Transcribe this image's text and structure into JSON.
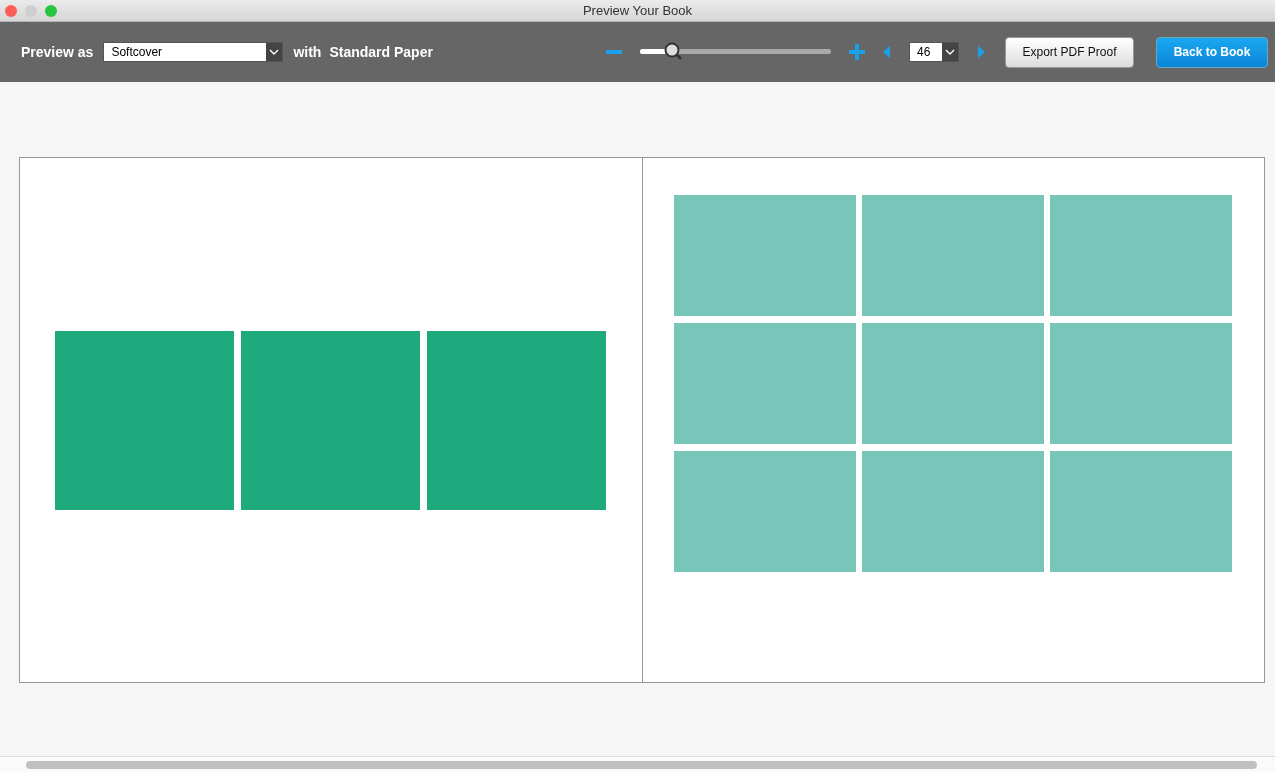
{
  "window": {
    "title": "Preview Your Book"
  },
  "toolbar": {
    "preview_label": "Preview as",
    "format": {
      "value": "Softcover"
    },
    "with_label": "with",
    "paper": "Standard Paper",
    "zoom": {
      "level": 0.17
    },
    "page": {
      "value": "46"
    },
    "buttons": [
      {
        "label": "Export PDF Proof",
        "kind": "secondary"
      },
      {
        "label": "Back to Book",
        "kind": "primary"
      }
    ]
  },
  "spread": {
    "pages": [
      {
        "kind": "row",
        "color": "#1eaa7c",
        "slots": [
          {
            "kind": "photo-slot"
          },
          {
            "kind": "photo-slot"
          },
          {
            "kind": "photo-slot"
          }
        ]
      },
      {
        "kind": "grid",
        "color": "#78c6ba",
        "slots": [
          {
            "kind": "photo-slot"
          },
          {
            "kind": "photo-slot"
          },
          {
            "kind": "photo-slot"
          },
          {
            "kind": "photo-slot"
          },
          {
            "kind": "photo-slot"
          },
          {
            "kind": "photo-slot"
          },
          {
            "kind": "photo-slot"
          },
          {
            "kind": "photo-slot"
          },
          {
            "kind": "photo-slot"
          }
        ]
      }
    ]
  }
}
